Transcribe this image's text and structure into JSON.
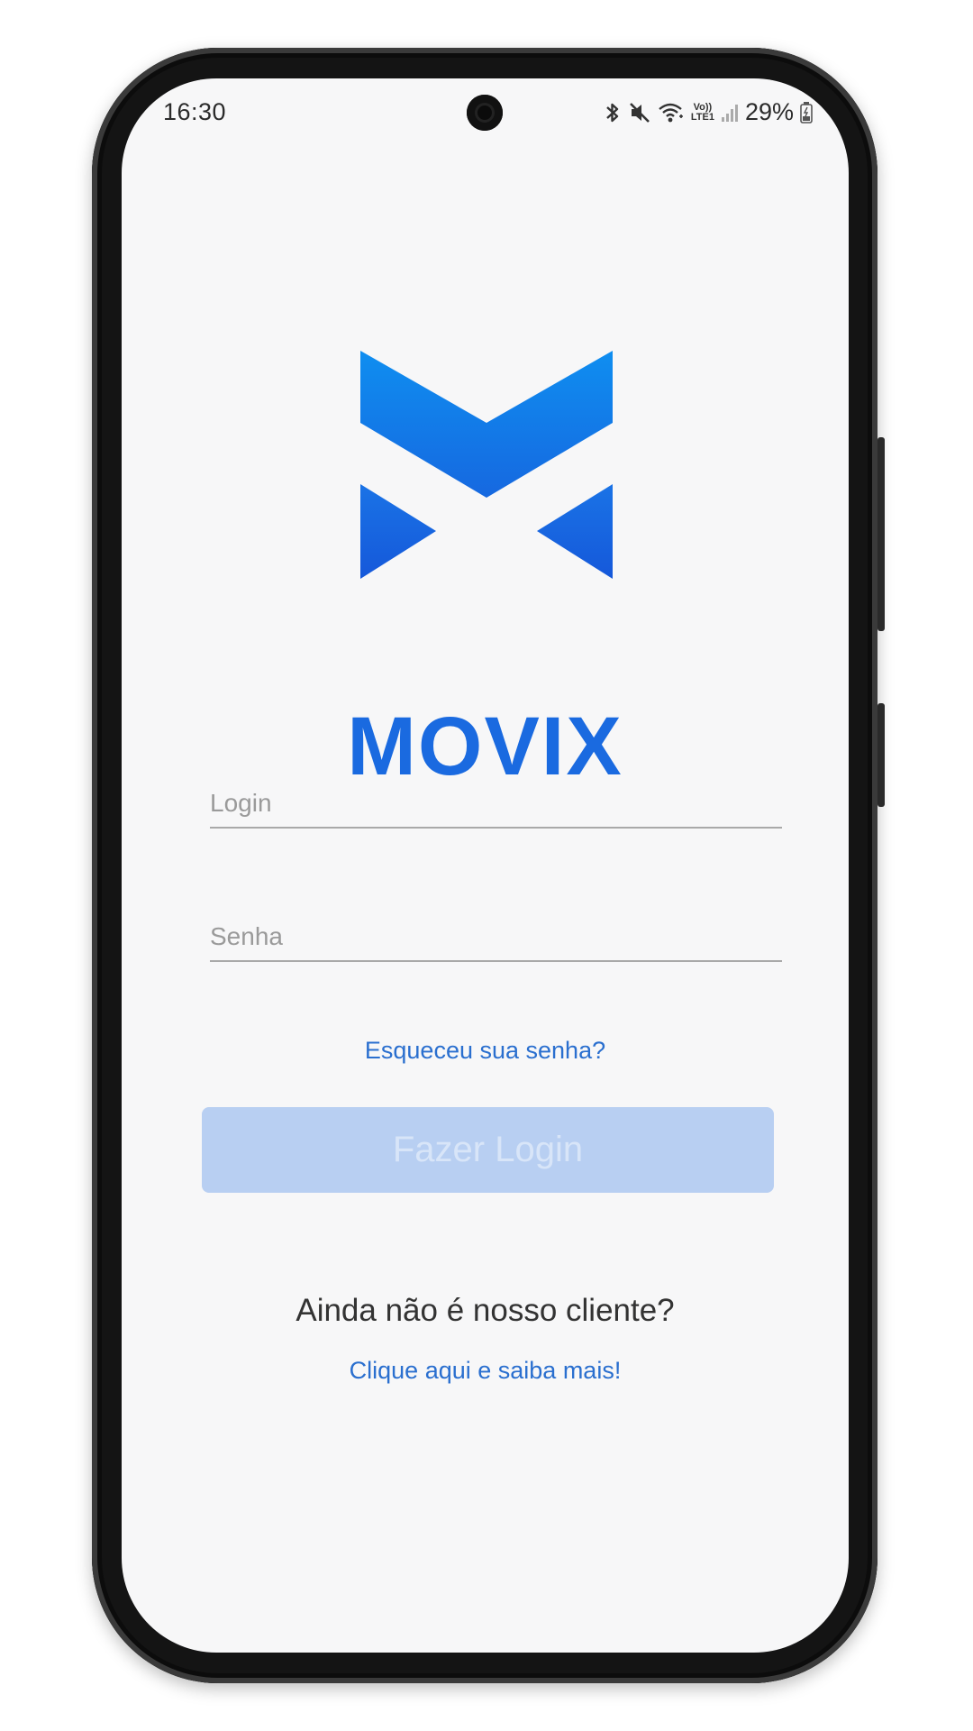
{
  "status_bar": {
    "time": "16:30",
    "battery": "29%",
    "network_label_top": "Vo))",
    "network_label_bottom": "LTE1",
    "icons": [
      "bluetooth-icon",
      "mute-icon",
      "wifi-icon",
      "signal-icon",
      "battery-icon"
    ]
  },
  "brand": {
    "name": "MOVIX",
    "logo_icon": "movix-logo-icon",
    "primary_color": "#1a6ae0",
    "gradient_top": "#0f8ef0",
    "gradient_bottom": "#1762e0"
  },
  "form": {
    "login_placeholder": "Login",
    "login_value": "",
    "password_placeholder": "Senha",
    "password_value": "",
    "forgot_link": "Esqueceu sua senha?",
    "submit_label": "Fazer Login",
    "submit_color": "#b8cff2"
  },
  "footer": {
    "prompt": "Ainda não é nosso cliente?",
    "signup_link": "Clique aqui e saiba mais!",
    "link_color": "#2a6fcf"
  }
}
